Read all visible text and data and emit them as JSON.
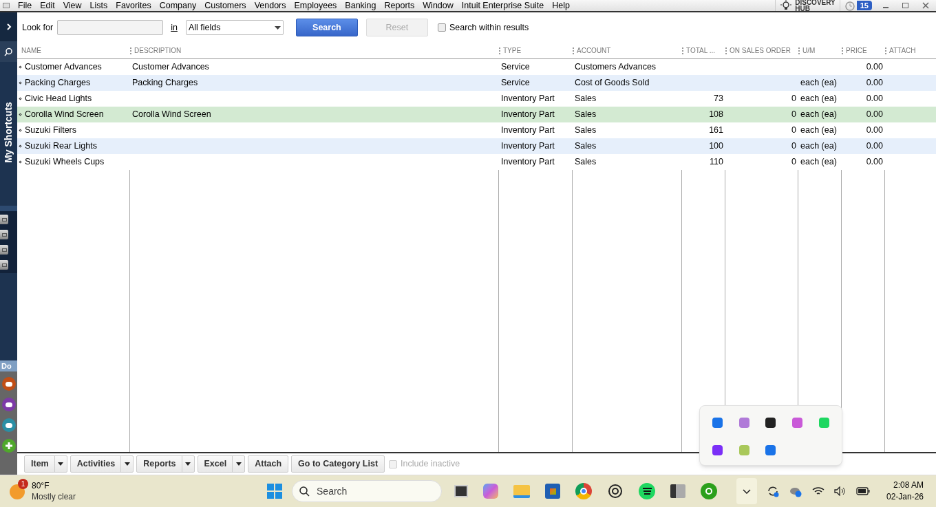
{
  "menu": [
    "File",
    "Edit",
    "View",
    "Lists",
    "Favorites",
    "Company",
    "Customers",
    "Vendors",
    "Employees",
    "Banking",
    "Reports",
    "Window",
    "Intuit Enterprise Suite",
    "Help"
  ],
  "discovery_hub": {
    "line1": "DISCOVERY",
    "line2": "HUB"
  },
  "reminders_badge": "15",
  "sidebar": {
    "title": "My Shortcuts",
    "section": "Do"
  },
  "search": {
    "look_for_label": "Look for",
    "in_label": "in",
    "field_value": "All fields",
    "search_button": "Search",
    "reset_button": "Reset",
    "reset_disabled": true,
    "within_results": {
      "label": "Search within results",
      "checked": false
    }
  },
  "table": {
    "columns": [
      "NAME",
      "DESCRIPTION",
      "TYPE",
      "ACCOUNT",
      "TOTAL ...",
      "ON SALES ORDER",
      "U/M",
      "PRICE",
      "ATTACH"
    ],
    "rows": [
      {
        "name": "Customer Advances",
        "description": "Customer Advances",
        "type": "Service",
        "account": "Customers Advances",
        "total": "",
        "on_sales_order": "",
        "um": "",
        "price": "0.00",
        "selected": false
      },
      {
        "name": "Packing Charges",
        "description": "Packing Charges",
        "type": "Service",
        "account": "Cost of Goods Sold",
        "total": "",
        "on_sales_order": "",
        "um": "each (ea)",
        "price": "0.00",
        "selected": false
      },
      {
        "name": "Civic Head Lights",
        "description": "",
        "type": "Inventory Part",
        "account": "Sales",
        "total": "73",
        "on_sales_order": "0",
        "um": "each (ea)",
        "price": "0.00",
        "selected": false
      },
      {
        "name": "Corolla Wind Screen",
        "description": "Corolla Wind Screen",
        "type": "Inventory Part",
        "account": "Sales",
        "total": "108",
        "on_sales_order": "0",
        "um": "each (ea)",
        "price": "0.00",
        "selected": true
      },
      {
        "name": "Suzuki Filters",
        "description": "",
        "type": "Inventory Part",
        "account": "Sales",
        "total": "161",
        "on_sales_order": "0",
        "um": "each (ea)",
        "price": "0.00",
        "selected": false
      },
      {
        "name": "Suzuki Rear Lights",
        "description": "",
        "type": "Inventory Part",
        "account": "Sales",
        "total": "100",
        "on_sales_order": "0",
        "um": "each (ea)",
        "price": "0.00",
        "selected": false
      },
      {
        "name": "Suzuki Wheels Cups",
        "description": "",
        "type": "Inventory Part",
        "account": "Sales",
        "total": "110",
        "on_sales_order": "0",
        "um": "each (ea)",
        "price": "0.00",
        "selected": false
      }
    ]
  },
  "bottom_buttons": [
    {
      "label": "Item",
      "dropdown": true
    },
    {
      "label": "Activities",
      "dropdown": true
    },
    {
      "label": "Reports",
      "dropdown": true
    },
    {
      "label": "Excel",
      "dropdown": true
    },
    {
      "label": "Attach",
      "dropdown": false
    },
    {
      "label": "Go to Category List",
      "dropdown": false
    }
  ],
  "include_inactive": {
    "label": "Include inactive",
    "checked": false,
    "disabled": true
  },
  "taskbar": {
    "weather_badge": "1",
    "temperature": "80°F",
    "condition": "Mostly clear",
    "search_placeholder": "Search",
    "time": "2:08 AM",
    "date": "02-Jan-26"
  }
}
